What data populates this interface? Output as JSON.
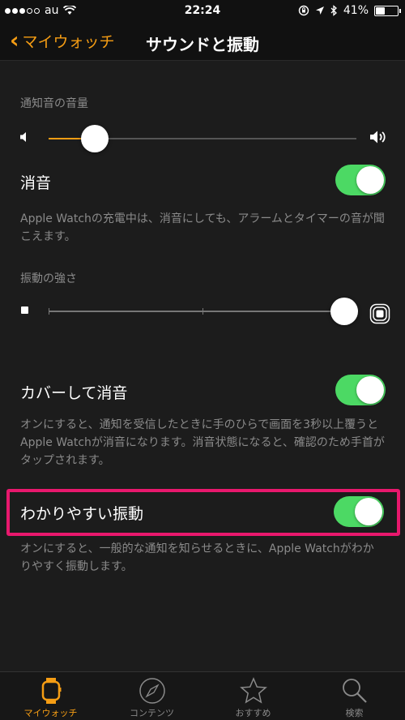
{
  "status_bar": {
    "carrier": "au",
    "time": "22:24",
    "battery": "41%",
    "battery_level": 0.41
  },
  "nav": {
    "back_label": "マイウォッチ",
    "title": "サウンドと振動"
  },
  "sections": {
    "notification_volume": {
      "header": "通知音の音量",
      "level": 0.15
    },
    "mute": {
      "label": "消音",
      "on": true,
      "footer": "Apple Watchの充電中は、消音にしても、アラームとタイマーの音が聞こえます。"
    },
    "haptic_strength": {
      "header": "振動の強さ",
      "level": 0.96
    },
    "cover_to_mute": {
      "label": "カバーして消音",
      "on": true,
      "footer": "オンにすると、通知を受信したときに手のひらで画面を3秒以上覆うとApple Watchが消音になります。消音状態になると、確認のため手首がタップされます。"
    },
    "prominent_haptic": {
      "label": "わかりやすい振動",
      "on": true,
      "footer": "オンにすると、一般的な通知を知らせるときに、Apple Watchがわかりやすく振動します。"
    }
  },
  "tabs": [
    {
      "label": "マイウォッチ",
      "icon": "watch-icon",
      "active": true
    },
    {
      "label": "コンテンツ",
      "icon": "compass-icon",
      "active": false
    },
    {
      "label": "おすすめ",
      "icon": "star-icon",
      "active": false
    },
    {
      "label": "検索",
      "icon": "search-icon",
      "active": false
    }
  ],
  "colors": {
    "accent": "#f59d14",
    "toggle_on": "#4cd964",
    "highlight": "#e8186d"
  }
}
